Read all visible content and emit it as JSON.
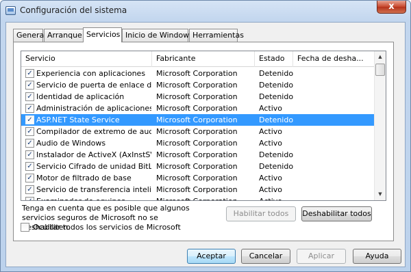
{
  "window": {
    "title": "Configuración del sistema",
    "close_label": "x"
  },
  "tabs": [
    {
      "label": "General",
      "active": false
    },
    {
      "label": "Arranque",
      "active": false
    },
    {
      "label": "Servicios",
      "active": true
    },
    {
      "label": "Inicio de Windows",
      "active": false
    },
    {
      "label": "Herramientas",
      "active": false
    }
  ],
  "table": {
    "columns": [
      "Servicio",
      "Fabricante",
      "Estado",
      "Fecha de desha..."
    ],
    "rows": [
      {
        "checked": true,
        "service": "Experiencia con aplicaciones",
        "maker": "Microsoft Corporation",
        "state": "Detenido",
        "date": ""
      },
      {
        "checked": true,
        "service": "Servicio de puerta de enlace de ...",
        "maker": "Microsoft Corporation",
        "state": "Detenido",
        "date": ""
      },
      {
        "checked": true,
        "service": "Identidad de aplicación",
        "maker": "Microsoft Corporation",
        "state": "Detenido",
        "date": ""
      },
      {
        "checked": true,
        "service": "Administración de aplicaciones",
        "maker": "Microsoft Corporation",
        "state": "Activo",
        "date": ""
      },
      {
        "checked": true,
        "service": "ASP.NET State Service",
        "maker": "Microsoft Corporation",
        "state": "Detenido",
        "date": "",
        "selected": true
      },
      {
        "checked": true,
        "service": "Compilador de extremo de audio...",
        "maker": "Microsoft Corporation",
        "state": "Activo",
        "date": ""
      },
      {
        "checked": true,
        "service": "Audio de Windows",
        "maker": "Microsoft Corporation",
        "state": "Activo",
        "date": ""
      },
      {
        "checked": true,
        "service": "Instalador de ActiveX (AxInstSV)",
        "maker": "Microsoft Corporation",
        "state": "Detenido",
        "date": ""
      },
      {
        "checked": true,
        "service": "Servicio Cifrado de unidad BitLoc...",
        "maker": "Microsoft Corporation",
        "state": "Detenido",
        "date": ""
      },
      {
        "checked": true,
        "service": "Motor de filtrado de base",
        "maker": "Microsoft Corporation",
        "state": "Activo",
        "date": ""
      },
      {
        "checked": true,
        "service": "Servicio de transferencia intelige...",
        "maker": "Microsoft Corporation",
        "state": "Activo",
        "date": ""
      },
      {
        "checked": true,
        "service": "Examinador de equipos",
        "maker": "Microsoft Corporation",
        "state": "Activo",
        "date": ""
      }
    ]
  },
  "note": "Tenga en cuenta que es posible que algunos servicios seguros de Microsoft no se deshabiliten.",
  "buttons": {
    "enable_all": "Habilitar todos",
    "disable_all": "Deshabilitar todos",
    "ok": "Aceptar",
    "cancel": "Cancelar",
    "apply": "Aplicar",
    "help": "Ayuda"
  },
  "hide_ms": {
    "label": "Ocultar todos los servicios de Microsoft",
    "checked": false
  },
  "colors": {
    "selection": "#3399ff",
    "close": "#c7462c"
  }
}
